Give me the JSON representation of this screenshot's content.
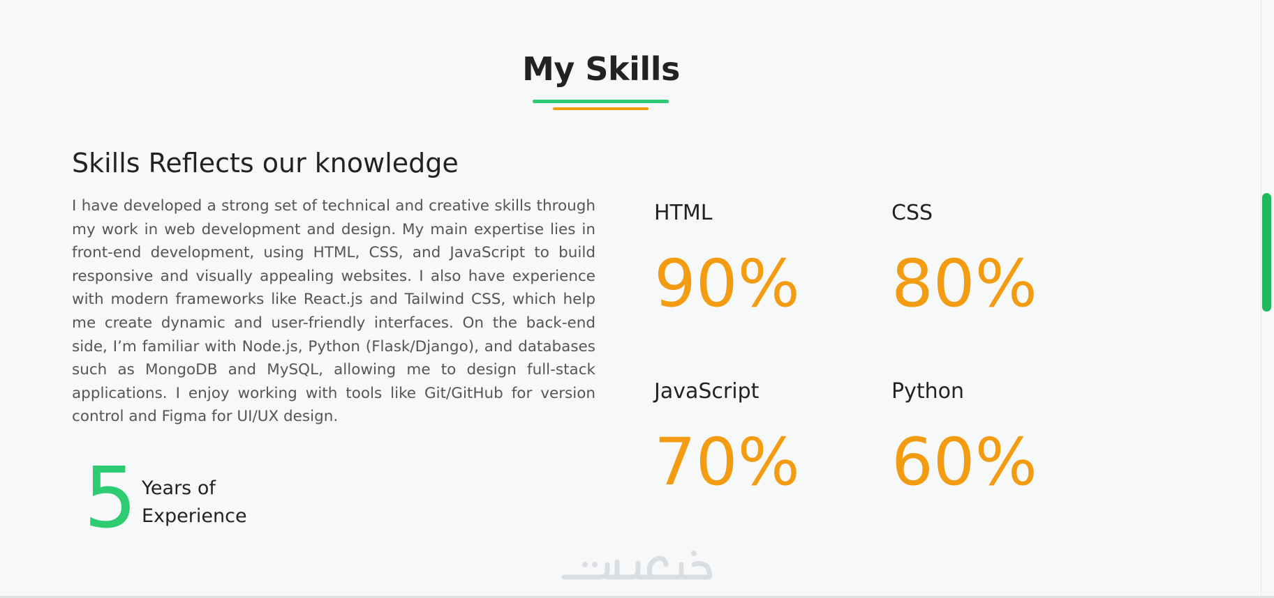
{
  "section": {
    "title": "My Skills",
    "accent_primary": "#2ecc71",
    "accent_secondary": "#f39c12"
  },
  "about": {
    "heading": "Skills Reflects our knowledge",
    "paragraph": "I have developed a strong set of technical and creative skills through my work in web development and design. My main expertise lies in front-end development, using HTML, CSS, and JavaScript to build responsive and visually appealing websites. I also have experience with modern frameworks like React.js and Tailwind CSS, which help me create dynamic and user-friendly interfaces. On the back-end side, I’m familiar with Node.js, Python (Flask/Django), and databases such as MongoDB and MySQL, allowing me to design full-stack applications. I enjoy working with tools like Git/GitHub for version control and Figma for UI/UX design."
  },
  "experience": {
    "number": "5",
    "label": "Years of Experience"
  },
  "skills": [
    {
      "name": "HTML",
      "percent": "90%"
    },
    {
      "name": "CSS",
      "percent": "80%"
    },
    {
      "name": "JavaScript",
      "percent": "70%"
    },
    {
      "name": "Python",
      "percent": "60%"
    }
  ],
  "watermark": {
    "text": "خمسات"
  }
}
